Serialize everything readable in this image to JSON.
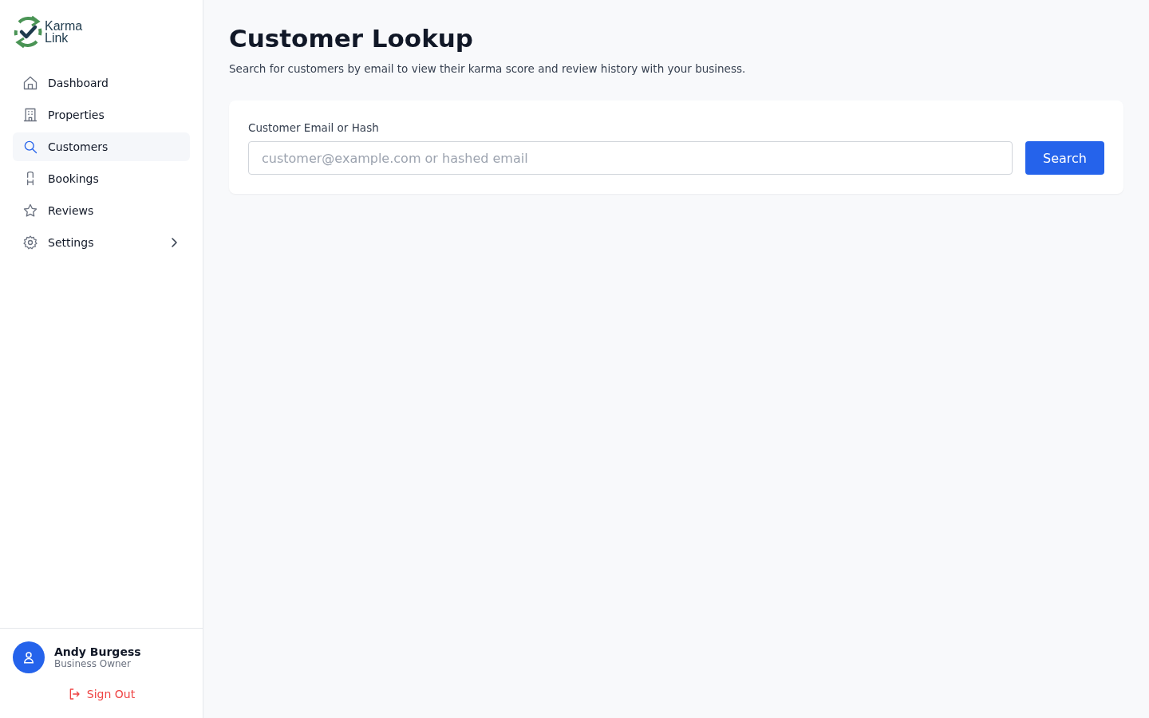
{
  "logo": {
    "line_1": "Karma",
    "line_2": "Link"
  },
  "sidebar": {
    "items": [
      {
        "label": "Dashboard",
        "kind": "link",
        "selected": false
      },
      {
        "label": "Properties",
        "kind": "link",
        "selected": false
      },
      {
        "label": "Customers",
        "kind": "link",
        "selected": true
      },
      {
        "label": "Bookings",
        "kind": "link",
        "selected": false
      },
      {
        "label": "Reviews",
        "kind": "link",
        "selected": false
      },
      {
        "label": "Settings",
        "kind": "group",
        "selected": false,
        "expanded": false
      }
    ]
  },
  "user": {
    "name": "Andy Burgess",
    "role": "Business Owner",
    "sign_out": "Sign Out"
  },
  "page": {
    "title": "Customer Lookup",
    "subtitle": "Search for customers by email to view their karma score and review history with your business."
  },
  "search": {
    "label": "Customer Email or Hash",
    "placeholder": "customer@example.com or hashed email",
    "button": "Search"
  }
}
